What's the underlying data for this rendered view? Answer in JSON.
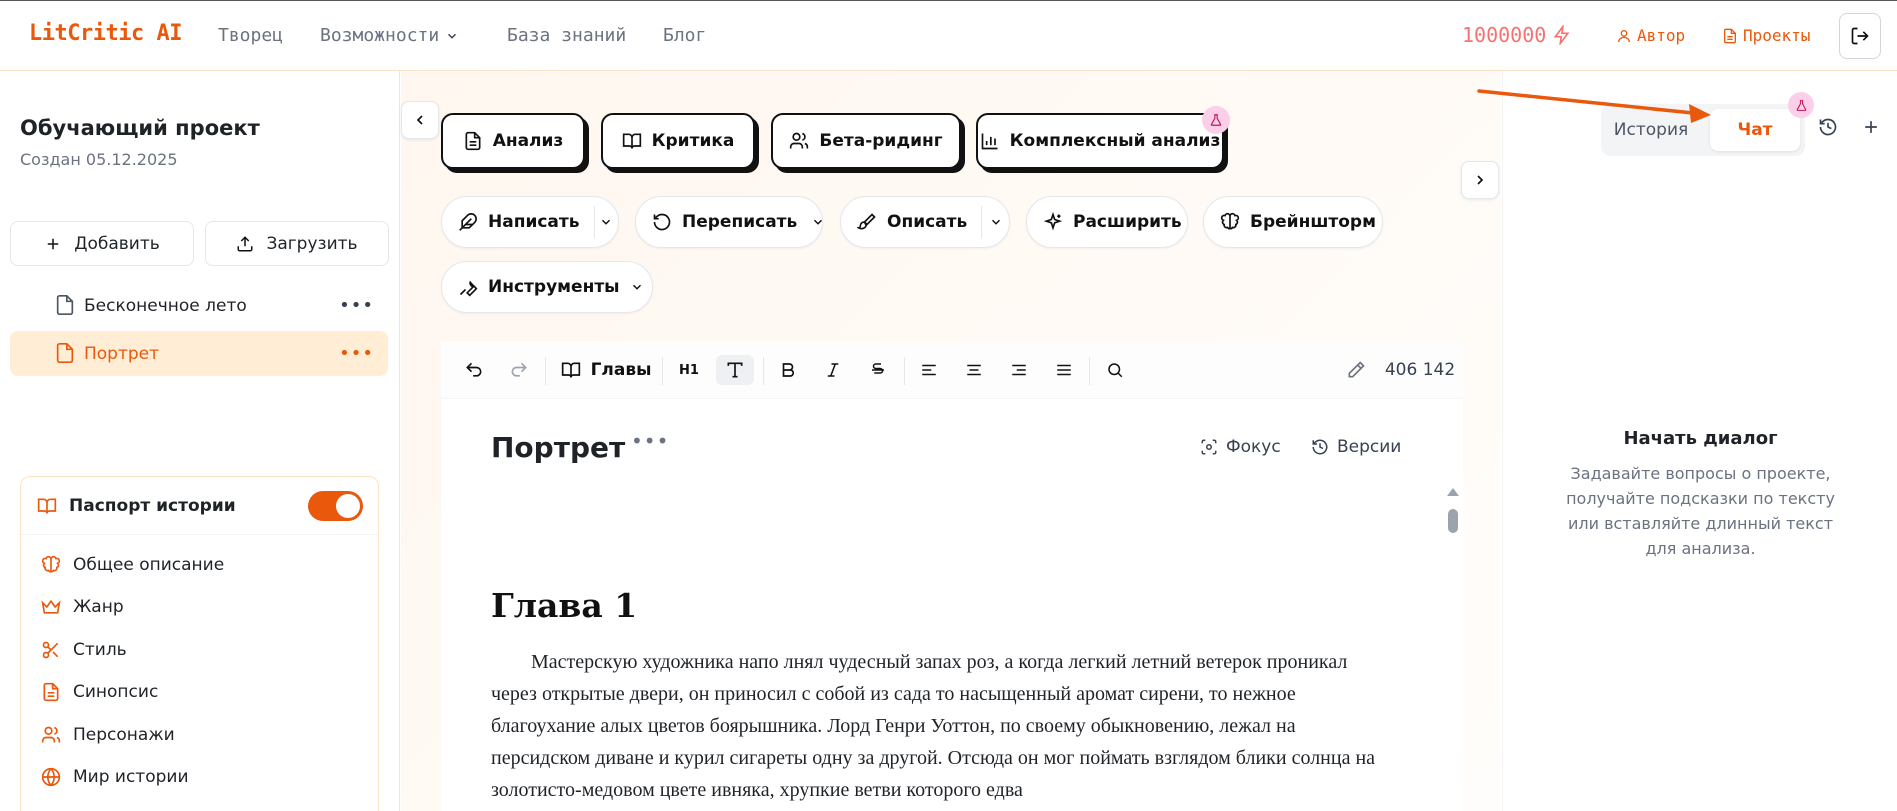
{
  "nav": {
    "logo": "LitCritic AI",
    "links": [
      "Творец",
      "Возможности",
      "База знаний",
      "Блог"
    ],
    "credits": "1000000",
    "author": "Автор",
    "projects": "Проекты"
  },
  "sidebar": {
    "project_title": "Обучающий проект",
    "project_date": "Создан 05.12.2025",
    "add_label": "Добавить",
    "upload_label": "Загрузить",
    "documents": [
      {
        "label": "Бесконечное лето",
        "active": false
      },
      {
        "label": "Портрет",
        "active": true
      }
    ],
    "passport": {
      "title": "Паспорт истории",
      "enabled": true,
      "items": [
        "Общее описание",
        "Жанр",
        "Стиль",
        "Синопсис",
        "Персонажи",
        "Мир истории"
      ]
    }
  },
  "main": {
    "modes": [
      "Анализ",
      "Критика",
      "Бета-ридинг",
      "Комплексный анализ"
    ],
    "actions": [
      "Написать",
      "Переписать",
      "Описать",
      "Расширить",
      "Брейншторм",
      "Инструменты"
    ],
    "toolbar": {
      "chapters_label": "Главы",
      "h1_label": "H1",
      "char_count": "406 142"
    },
    "document": {
      "title": "Портрет",
      "focus_label": "Фокус",
      "versions_label": "Версии",
      "chapter_heading": "Глава 1",
      "body": "Мастерскую художника напо лнял чудесный запах роз, а когда легкий летний ветерок проникал через открытые двери, он приносил с собой из сада то насыщенный аромат сирени, то нежное благоухание алых цветов боярышника. Лорд Генри Уоттон, по своему обыкновению, лежал на персидском диване и курил сигареты одну за другой. Отсюда он мог поймать взглядом блики солнца на золотисто-медовом цвете ивняка, хрупкие ветви которого едва"
    }
  },
  "right_panel": {
    "tab_history": "История",
    "tab_chat": "Чат",
    "active_tab": "Чат",
    "empty_title": "Начать диалог",
    "empty_text": "Задавайте вопросы о проекте, получайте подсказки по тексту или вставляйте длинный текст для анализа."
  },
  "colors": {
    "accent": "#ea580c",
    "credits": "#f87171",
    "beaker_bg": "#fbcfe8"
  }
}
